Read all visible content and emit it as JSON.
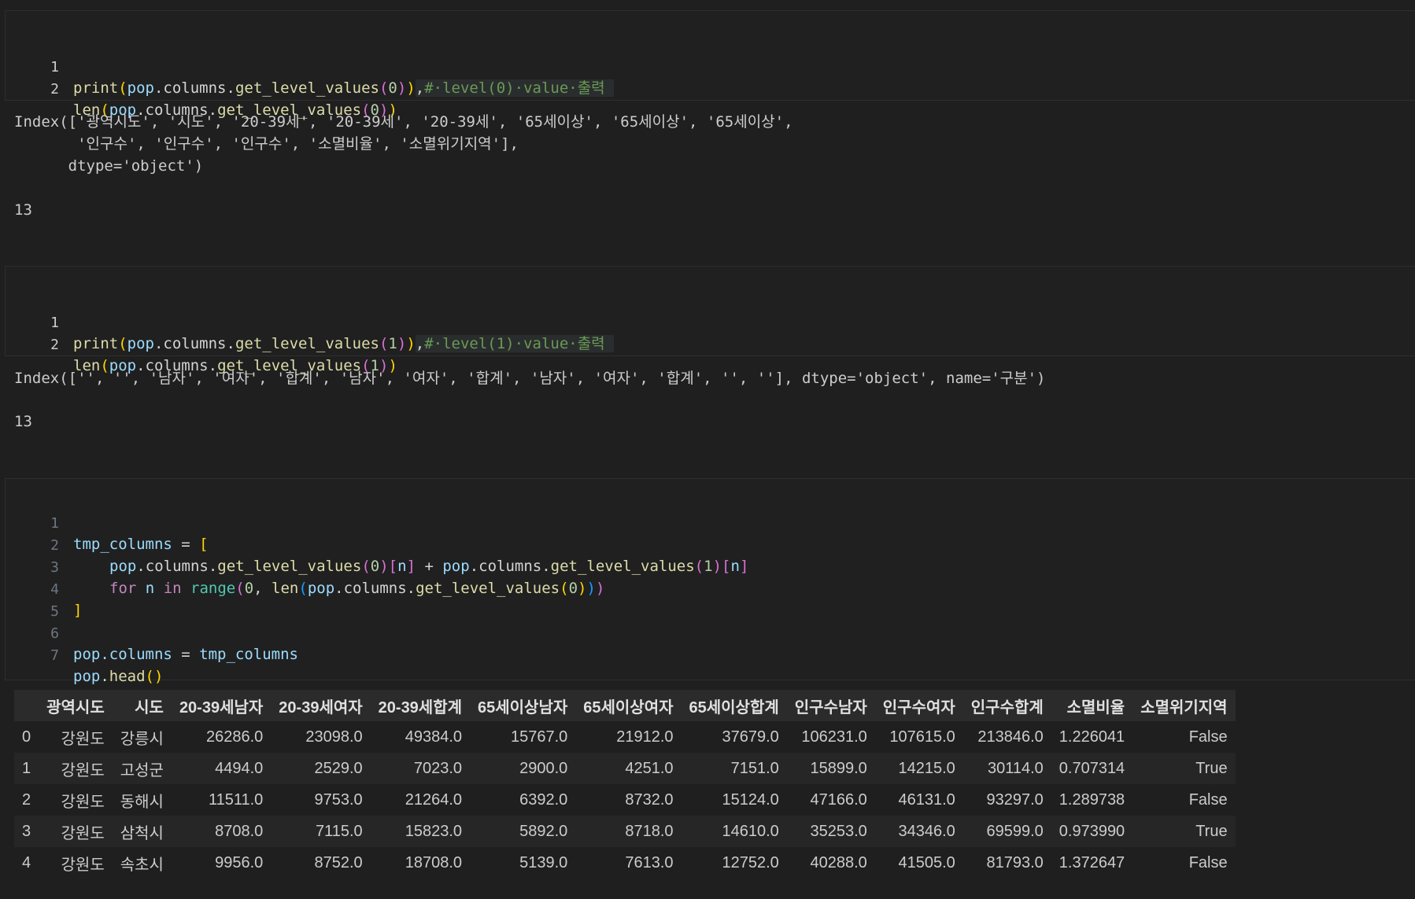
{
  "cell1": {
    "lines": [
      {
        "no": "1"
      },
      {
        "no": "2"
      }
    ],
    "line1": {
      "a": "print",
      "b": "(",
      "c": "pop",
      "d": ".columns.",
      "e": "get_level_values",
      "f": "(",
      "g": "0",
      "h": ")",
      ")": ")",
      "i": ",",
      "cmt": "#·level(0)·value·출력"
    },
    "line2": {
      "a": "len",
      "b": "(",
      "c": "pop",
      "d": ".columns.",
      "e": "get_level_values",
      "f": "(",
      "g": "0",
      "h": ")",
      "j": ")"
    },
    "output1": "Index(['광역시도', '시도', '20-39세', '20-39세', '20-39세', '65세이상', '65세이상', '65세이상',\n       '인구수', '인구수', '인구수', '소멸비율', '소멸위기지역'],\n      dtype='object')",
    "output2": "13"
  },
  "cell2": {
    "line1": {
      "a": "print",
      "b": "(",
      "c": "pop",
      "d": ".columns.",
      "e": "get_level_values",
      "f": "(",
      "g": "1",
      "h": ")",
      ")": ")",
      "i": ",",
      "cmt": "#·level(1)·value·출력"
    },
    "line2": {
      "a": "len",
      "b": "(",
      "c": "pop",
      "d": ".columns.",
      "e": "get_level_values",
      "f": "(",
      "g": "1",
      "h": ")",
      "j": ")"
    },
    "output1": "Index(['', '', '남자', '여자', '합계', '남자', '여자', '합계', '남자', '여자', '합계', '', ''], dtype='object', name='구분')",
    "output2": "13"
  },
  "cell3": {
    "line_numbers": [
      "1",
      "2",
      "3",
      "4",
      "5",
      "6",
      "7"
    ],
    "l1": {
      "v": "tmp_columns",
      "op": " = ",
      "br": "["
    },
    "l2": {
      "v1": "pop",
      "t1": ".columns.",
      "f1": "get_level_values",
      "p1": "(",
      "n1": "0",
      "p1c": ")",
      "b1": "[",
      "n": "n",
      "b1c": "]",
      "plus": " + ",
      "v2": "pop",
      "t2": ".columns.",
      "f2": "get_level_values",
      "p2": "(",
      "n2": "1",
      "p2c": ")",
      "b2": "[",
      "nn": "n",
      "b2c": "]"
    },
    "l3": {
      "kw1": "for",
      "sp1": " ",
      "n": "n",
      "sp2": " ",
      "kw2": "in",
      "sp3": " ",
      "bi": "range",
      "p": "(",
      "z": "0",
      "c": ", ",
      "len": "len",
      "p2": "(",
      "v": "pop",
      "t": ".columns.",
      "f": "get_level_values",
      "p3": "(",
      "zz": "0",
      "p3c": ")",
      "p2c": ")",
      "pc": ")"
    },
    "l4": {
      "br": "]"
    },
    "l6": {
      "v": "pop",
      "t": ".columns",
      "op": " = ",
      "v2": "tmp_columns"
    },
    "l7": {
      "v": "pop",
      "t": ".",
      "f": "head",
      "p": "()"
    }
  },
  "table": {
    "headers": [
      "",
      "광역시도",
      "시도",
      "20-39세남자",
      "20-39세여자",
      "20-39세합계",
      "65세이상남자",
      "65세이상여자",
      "65세이상합계",
      "인구수남자",
      "인구수여자",
      "인구수합계",
      "소멸비율",
      "소멸위기지역"
    ],
    "rows": [
      [
        "0",
        "강원도",
        "강릉시",
        "26286.0",
        "23098.0",
        "49384.0",
        "15767.0",
        "21912.0",
        "37679.0",
        "106231.0",
        "107615.0",
        "213846.0",
        "1.226041",
        "False"
      ],
      [
        "1",
        "강원도",
        "고성군",
        "4494.0",
        "2529.0",
        "7023.0",
        "2900.0",
        "4251.0",
        "7151.0",
        "15899.0",
        "14215.0",
        "30114.0",
        "0.707314",
        "True"
      ],
      [
        "2",
        "강원도",
        "동해시",
        "11511.0",
        "9753.0",
        "21264.0",
        "6392.0",
        "8732.0",
        "15124.0",
        "47166.0",
        "46131.0",
        "93297.0",
        "1.289738",
        "False"
      ],
      [
        "3",
        "강원도",
        "삼척시",
        "8708.0",
        "7115.0",
        "15823.0",
        "5892.0",
        "8718.0",
        "14610.0",
        "35253.0",
        "34346.0",
        "69599.0",
        "0.973990",
        "True"
      ],
      [
        "4",
        "강원도",
        "속초시",
        "9956.0",
        "8752.0",
        "18708.0",
        "5139.0",
        "7613.0",
        "12752.0",
        "40288.0",
        "41505.0",
        "81793.0",
        "1.372647",
        "False"
      ]
    ]
  }
}
